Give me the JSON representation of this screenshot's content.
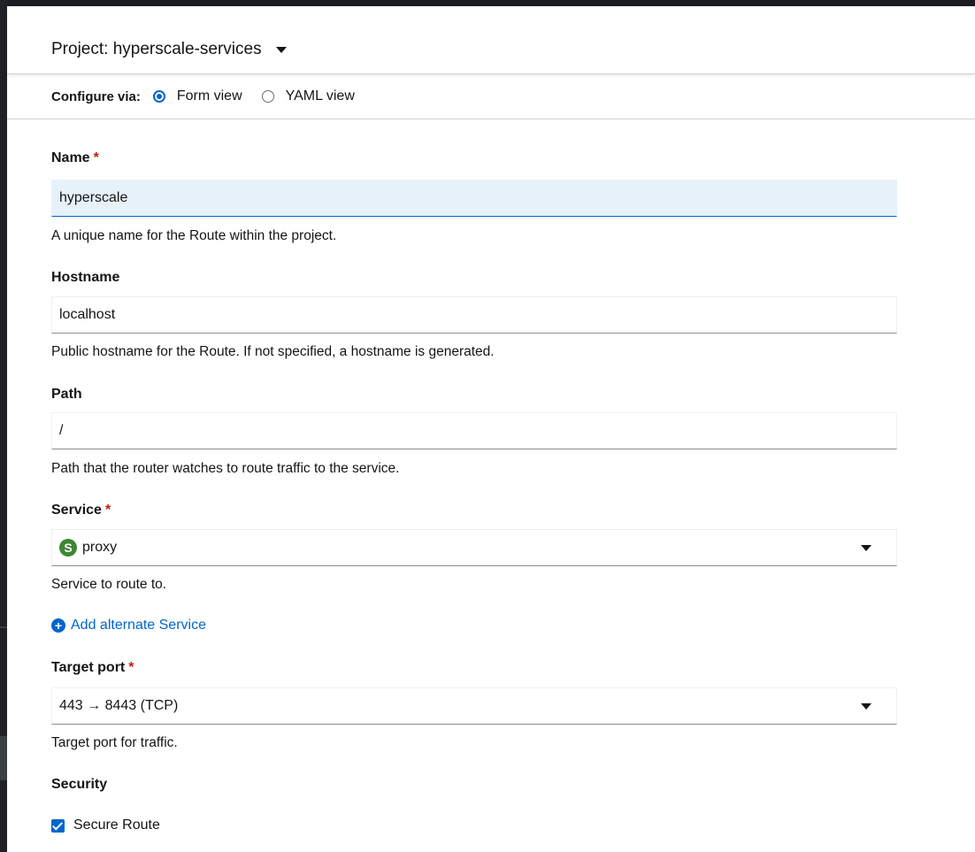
{
  "project": {
    "label": "Project: hyperscale-services"
  },
  "configure": {
    "label": "Configure via:",
    "options": [
      "Form view",
      "YAML view"
    ],
    "selected": "Form view"
  },
  "form": {
    "name": {
      "label": "Name",
      "value": "hyperscale",
      "help": "A unique name for the Route within the project."
    },
    "hostname": {
      "label": "Hostname",
      "value": "localhost",
      "help": "Public hostname for the Route. If not specified, a hostname is generated."
    },
    "path": {
      "label": "Path",
      "value": "/",
      "help": "Path that the router watches to route traffic to the service."
    },
    "service": {
      "label": "Service",
      "badge": "S",
      "value": "proxy",
      "help": "Service to route to."
    },
    "add_alternate": "Add alternate Service",
    "target_port": {
      "label": "Target port",
      "value": "443 → 8443 (TCP)",
      "help": "Target port for traffic."
    },
    "security": {
      "label": "Security",
      "secure_route_label": "Secure Route",
      "secure_route_checked": true
    },
    "required_mark": "*"
  },
  "colors": {
    "accent": "#0066cc",
    "required": "#c9190b",
    "service_badge": "#3e8635"
  },
  "icons": {
    "project_caret": "caret-down-icon",
    "add_alternate": "plus-circle-icon",
    "select_caret": "caret-down-icon"
  }
}
